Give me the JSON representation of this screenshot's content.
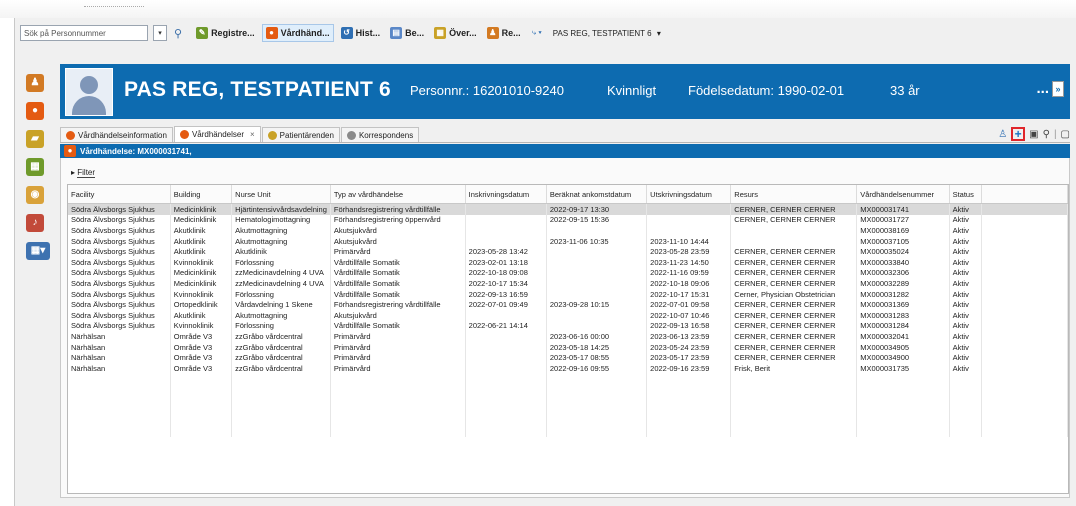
{
  "toolbar": {
    "search_placeholder": "Sök på Personnummer",
    "buttons": [
      {
        "label": "Registre...",
        "color": "#6f9a2b",
        "glyph": "✎",
        "active": false
      },
      {
        "label": "Vårdhänd...",
        "color": "#e45b12",
        "glyph": "●",
        "active": true
      },
      {
        "label": "Hist...",
        "color": "#2f6fb3",
        "glyph": "↺",
        "active": false
      },
      {
        "label": "Be...",
        "color": "#5a87c7",
        "glyph": "▤",
        "active": false
      },
      {
        "label": "Över...",
        "color": "#c9a227",
        "glyph": "▦",
        "active": false
      },
      {
        "label": "Re...",
        "color": "#d37a22",
        "glyph": "♟",
        "active": false
      }
    ],
    "patient_menu": "PAS REG, TESTPATIENT 6"
  },
  "banner": {
    "name": "PAS REG, TESTPATIENT 6",
    "personnr": "Personnr.: 16201010-9240",
    "gender": "Kvinnligt",
    "birthdate": "Födelsedatum: 1990-02-01",
    "age": "33 år",
    "more": "...",
    "more_arrow": "»"
  },
  "tabs": [
    {
      "label": "Vårdhändelseinformation",
      "color": "#e45b12",
      "selected": false
    },
    {
      "label": "Vårdhändelser",
      "color": "#e45b12",
      "selected": true
    },
    {
      "label": "Patientärenden",
      "color": "#c9a227",
      "selected": false
    },
    {
      "label": "Korrespondens",
      "color": "#8a8a8a",
      "selected": false
    }
  ],
  "tab_close": "×",
  "vardhandelse_bar": "Vårdhändelse: MX000031741,",
  "filter_label": "Filter",
  "table": {
    "columns": [
      "Facility",
      "Building",
      "Nurse Unit",
      "Typ av vårdhändelse",
      "Inskrivningsdatum",
      "Beräknat ankomstdatum",
      "Utskrivningsdatum",
      "Resurs",
      "Vårdhändelsenummer",
      "Status"
    ],
    "rows": [
      [
        "Södra Älvsborgs Sjukhus",
        "Medicinklinik",
        "Hjärtintensivvårdsavdelning",
        "Förhandsregistrering vårdtillfälle",
        "",
        "2022-09-17 13:30",
        "",
        "CERNER, CERNER CERNER",
        "MX000031741",
        "Aktiv"
      ],
      [
        "Södra Älvsborgs Sjukhus",
        "Medicinklinik",
        "Hematologimottagning",
        "Förhandsregistrering öppenvård",
        "",
        "2022-09-15 15:36",
        "",
        "CERNER, CERNER CERNER",
        "MX000031727",
        "Aktiv"
      ],
      [
        "Södra Älvsborgs Sjukhus",
        "Akutklinik",
        "Akutmottagning",
        "Akutsjukvård",
        "",
        "",
        "",
        "",
        "MX000038169",
        "Aktiv"
      ],
      [
        "Södra Älvsborgs Sjukhus",
        "Akutklinik",
        "Akutmottagning",
        "Akutsjukvård",
        "",
        "2023-11-06 10:35",
        "2023-11-10 14:44",
        "",
        "MX000037105",
        "Aktiv"
      ],
      [
        "Södra Älvsborgs Sjukhus",
        "Akutklinik",
        "Akutklinik",
        "Primärvård",
        "2023-05-28 13:42",
        "",
        "2023-05-28 23:59",
        "CERNER, CERNER CERNER",
        "MX000035024",
        "Aktiv"
      ],
      [
        "Södra Älvsborgs Sjukhus",
        "Kvinnoklinik",
        "Förlossning",
        "Vårdtillfälle Somatik",
        "2023-02-01 13:18",
        "",
        "2023-11-23 14:50",
        "CERNER, CERNER CERNER",
        "MX000033840",
        "Aktiv"
      ],
      [
        "Södra Älvsborgs Sjukhus",
        "Medicinklinik",
        "zzMedicinavdelning 4 UVA",
        "Vårdtillfälle Somatik",
        "2022-10-18 09:08",
        "",
        "2022-11-16 09:59",
        "CERNER, CERNER CERNER",
        "MX000032306",
        "Aktiv"
      ],
      [
        "Södra Älvsborgs Sjukhus",
        "Medicinklinik",
        "zzMedicinavdelning 4 UVA",
        "Vårdtillfälle Somatik",
        "2022-10-17 15:34",
        "",
        "2022-10-18 09:06",
        "CERNER, CERNER CERNER",
        "MX000032289",
        "Aktiv"
      ],
      [
        "Södra Älvsborgs Sjukhus",
        "Kvinnoklinik",
        "Förlossning",
        "Vårdtillfälle Somatik",
        "2022-09-13 16:59",
        "",
        "2022-10-17 15:31",
        "Cerner, Physician Obstetrician",
        "MX000031282",
        "Aktiv"
      ],
      [
        "Södra Älvsborgs Sjukhus",
        "Ortopedklinik",
        "Vårdavdelning 1 Skene",
        "Förhandsregistrering vårdtillfälle",
        "2022-07-01 09:49",
        "2023-09-28 10:15",
        "2022-07-01 09:58",
        "CERNER, CERNER CERNER",
        "MX000031369",
        "Aktiv"
      ],
      [
        "Södra Älvsborgs Sjukhus",
        "Akutklinik",
        "Akutmottagning",
        "Akutsjukvård",
        "",
        "",
        "2022-10-07 10:46",
        "CERNER, CERNER CERNER",
        "MX000031283",
        "Aktiv"
      ],
      [
        "Södra Älvsborgs Sjukhus",
        "Kvinnoklinik",
        "Förlossning",
        "Vårdtillfälle Somatik",
        "2022-06-21 14:14",
        "",
        "2022-09-13 16:58",
        "CERNER, CERNER CERNER",
        "MX000031284",
        "Aktiv"
      ],
      [
        "Närhälsan",
        "Område V3",
        "zzGråbo vårdcentral",
        "Primärvård",
        "",
        "2023-06-16 00:00",
        "2023-06-13 23:59",
        "CERNER, CERNER CERNER",
        "MX000032041",
        "Aktiv"
      ],
      [
        "Närhälsan",
        "Område V3",
        "zzGråbo vårdcentral",
        "Primärvård",
        "",
        "2023-05-18 14:25",
        "2023-05-24 23:59",
        "CERNER, CERNER CERNER",
        "MX000034905",
        "Aktiv"
      ],
      [
        "Närhälsan",
        "Område V3",
        "zzGråbo vårdcentral",
        "Primärvård",
        "",
        "2023-05-17 08:55",
        "2023-05-17 23:59",
        "CERNER, CERNER CERNER",
        "MX000034900",
        "Aktiv"
      ],
      [
        "Närhälsan",
        "Område V3",
        "zzGråbo vårdcentral",
        "Primärvård",
        "",
        "2022-09-16 09:55",
        "2022-09-16 23:59",
        "Frisk, Berit",
        "MX000031735",
        "Aktiv"
      ]
    ],
    "selected_row": 0
  },
  "icons": {
    "search": "magnifier-icon",
    "add": "plus-icon",
    "save": "save-icon",
    "link": "link-icon"
  }
}
